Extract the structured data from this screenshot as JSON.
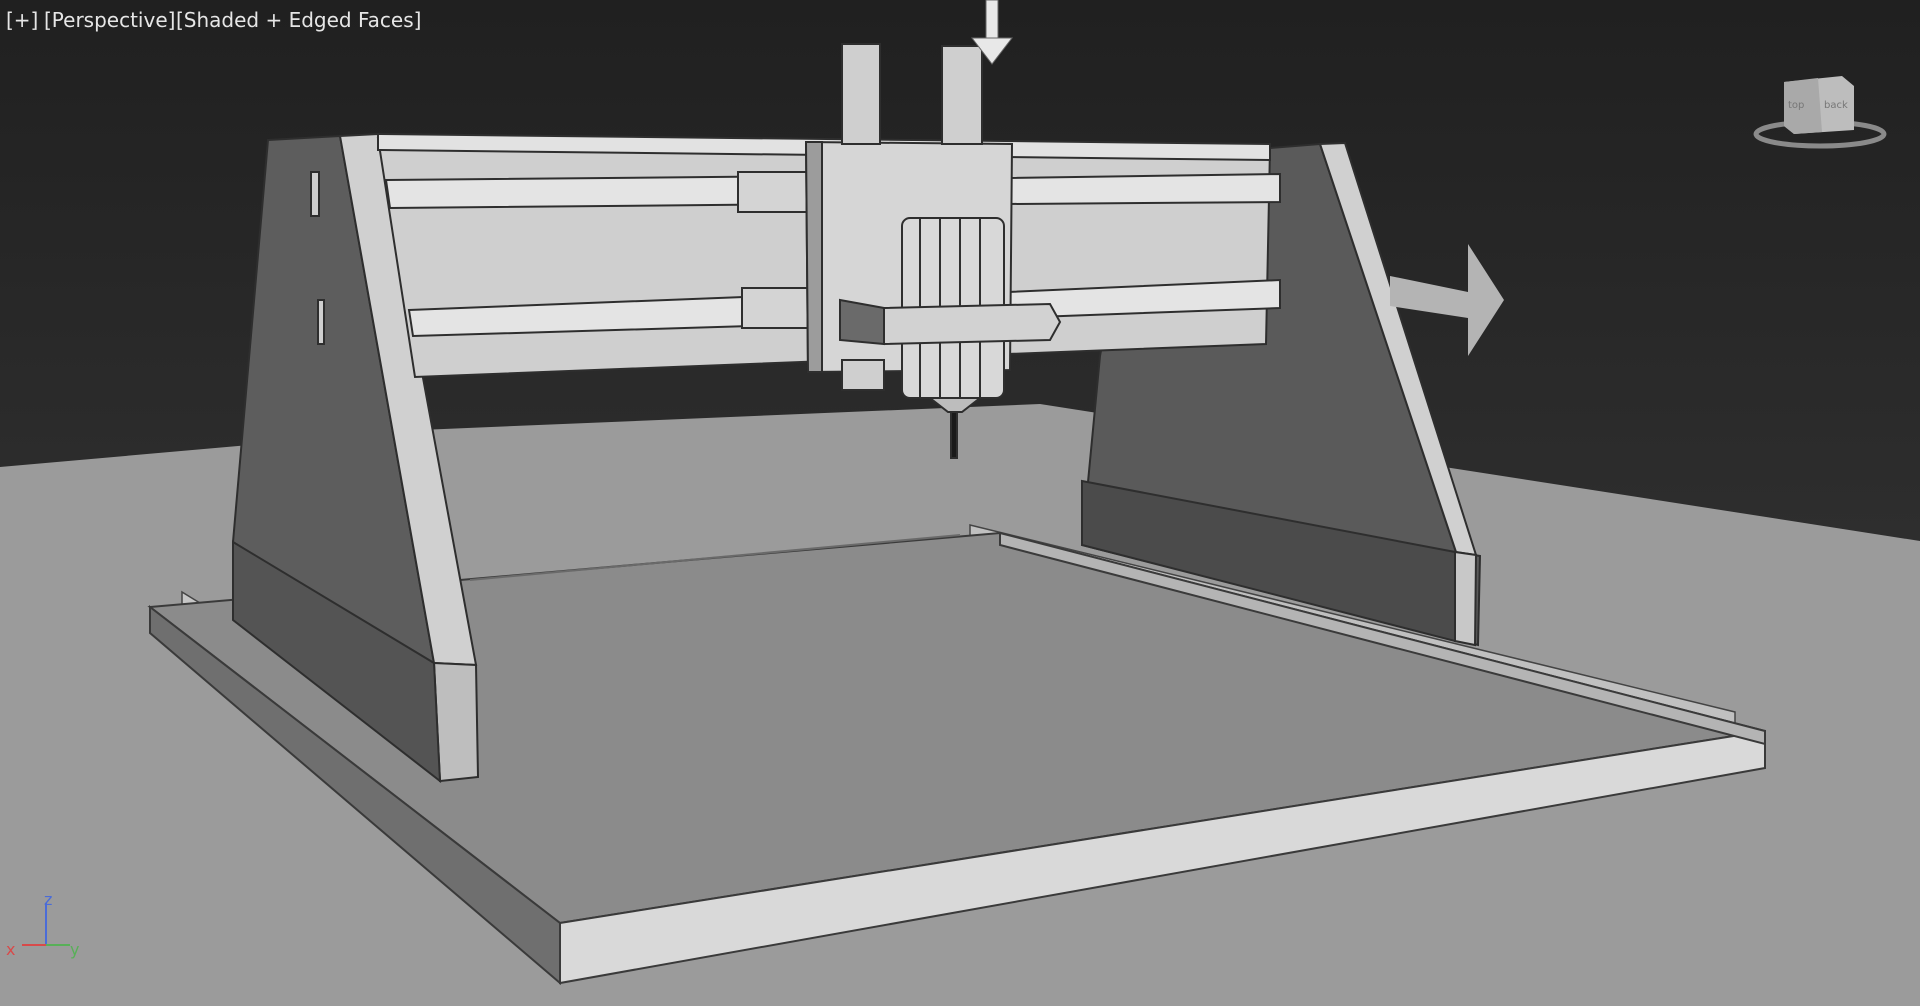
{
  "viewport": {
    "menu_label": "[+]",
    "view_label": "[Perspective]",
    "shading_label": "[Shaded + Edged Faces]"
  },
  "viewcube": {
    "face_left": "top",
    "face_right": "back"
  },
  "axis_tripod": {
    "x": "x",
    "y": "y",
    "z": "z"
  },
  "colors": {
    "background": "#2a2a2a",
    "ground": "#9a9a9a",
    "axis_x": "#d84a4a",
    "axis_y": "#58b058",
    "axis_z": "#4a6cd8"
  },
  "icons": [
    "viewcube-icon",
    "move-gizmo-down-arrow-icon",
    "move-gizmo-right-arrow-icon",
    "axis-tripod-icon"
  ]
}
